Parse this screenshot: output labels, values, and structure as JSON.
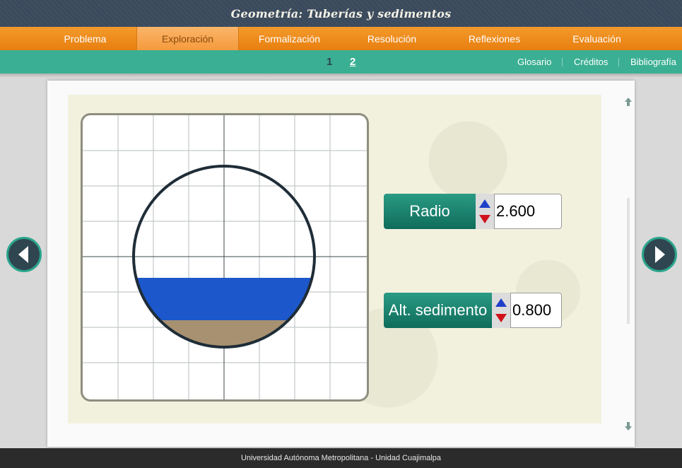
{
  "header": {
    "title": "Geometría: Tuberías y sedimentos"
  },
  "main_nav": {
    "tabs": [
      {
        "label": "Problema",
        "active": false
      },
      {
        "label": "Exploración",
        "active": true
      },
      {
        "label": "Formalización",
        "active": false
      },
      {
        "label": "Resolución",
        "active": false
      },
      {
        "label": "Reflexiones",
        "active": false
      },
      {
        "label": "Evaluación",
        "active": false
      }
    ]
  },
  "sub_nav": {
    "pages": [
      "1",
      "2"
    ],
    "current_page": "2",
    "links": [
      "Glosario",
      "Créditos",
      "Bibliografía"
    ]
  },
  "controls": {
    "radius": {
      "label": "Radio",
      "value": "2.600"
    },
    "sediment_height": {
      "label": "Alt. sedimento",
      "value": "0.800"
    }
  },
  "colors": {
    "water": "#1c57cc",
    "sediment": "#a89170",
    "pipe_outline": "#1f2d38",
    "accent_orange": "#f08a1c",
    "accent_teal": "#3aaf93"
  },
  "footer": {
    "text": "Universidad Autónoma Metropolitana - Unidad Cuajimalpa"
  }
}
